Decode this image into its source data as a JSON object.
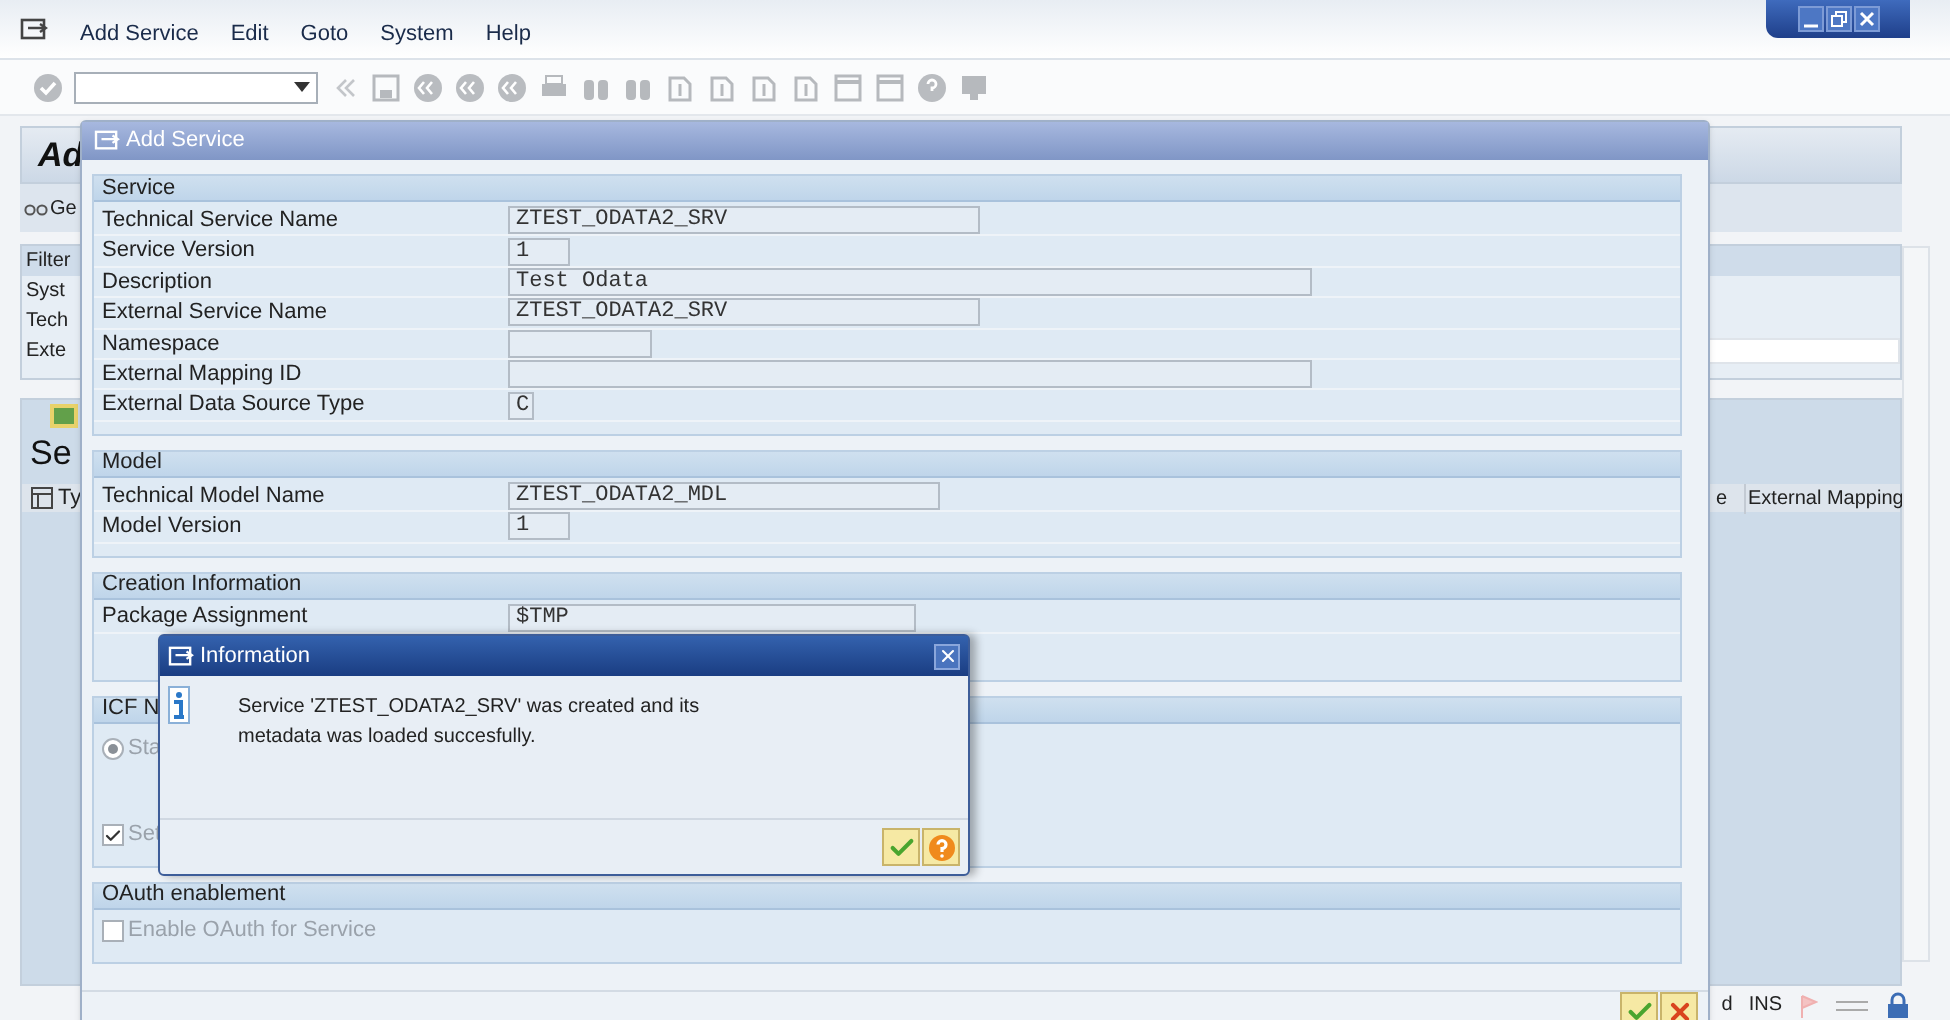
{
  "menu_bar": {
    "items": [
      "Add Service",
      "Edit",
      "Goto",
      "System",
      "Help"
    ]
  },
  "main_window": {
    "title": "Ad",
    "toolbar_button": "Ge",
    "filter": {
      "title": "Filter",
      "labels": [
        "Syst",
        "Tech",
        "Exte"
      ]
    },
    "table": {
      "title": "Se",
      "columns": [
        "Ty",
        "e",
        "External Mapping"
      ]
    }
  },
  "add_service_dialog": {
    "title": "Add Service",
    "sections": [
      {
        "title": "Service",
        "items": [
          {
            "kind": "field",
            "label": "Technical Service Name",
            "value": "ZTEST_ODATA2_SRV"
          },
          {
            "kind": "field",
            "label": "Service Version",
            "value": "1"
          },
          {
            "kind": "field",
            "label": "Description",
            "value": "Test Odata"
          },
          {
            "kind": "field",
            "label": "External Service Name",
            "value": "ZTEST_ODATA2_SRV"
          },
          {
            "kind": "field",
            "label": "Namespace"
          },
          {
            "kind": "field",
            "label": "External Mapping ID"
          },
          {
            "kind": "field",
            "label": "External Data Source Type",
            "value": "C"
          }
        ]
      },
      {
        "title": "Model",
        "items": [
          {
            "kind": "field",
            "label": "Technical Model Name",
            "value": "ZTEST_ODATA2_MDL"
          },
          {
            "kind": "field",
            "label": "Model Version",
            "value": "1"
          }
        ]
      },
      {
        "title": "Creation Information",
        "items": [
          {
            "kind": "field",
            "label": "Package Assignment",
            "value": "$TMP"
          }
        ]
      },
      {
        "title": "ICF N",
        "items": [
          {
            "kind": "radio",
            "label": "Sta",
            "selected": true,
            "disabled": true
          },
          {
            "kind": "checkbox",
            "label": "Set",
            "checked": true,
            "disabled": true
          }
        ]
      },
      {
        "title": "OAuth enablement",
        "items": [
          {
            "kind": "checkbox",
            "label": "Enable OAuth for Service",
            "checked": false,
            "disabled": true
          }
        ]
      }
    ]
  },
  "information_dialog": {
    "title": "Information",
    "message": "Service 'ZTEST_ODATA2_SRV' was created and its metadata was loaded succesfully."
  },
  "status_bar": {
    "items": [
      "d",
      "INS"
    ]
  }
}
